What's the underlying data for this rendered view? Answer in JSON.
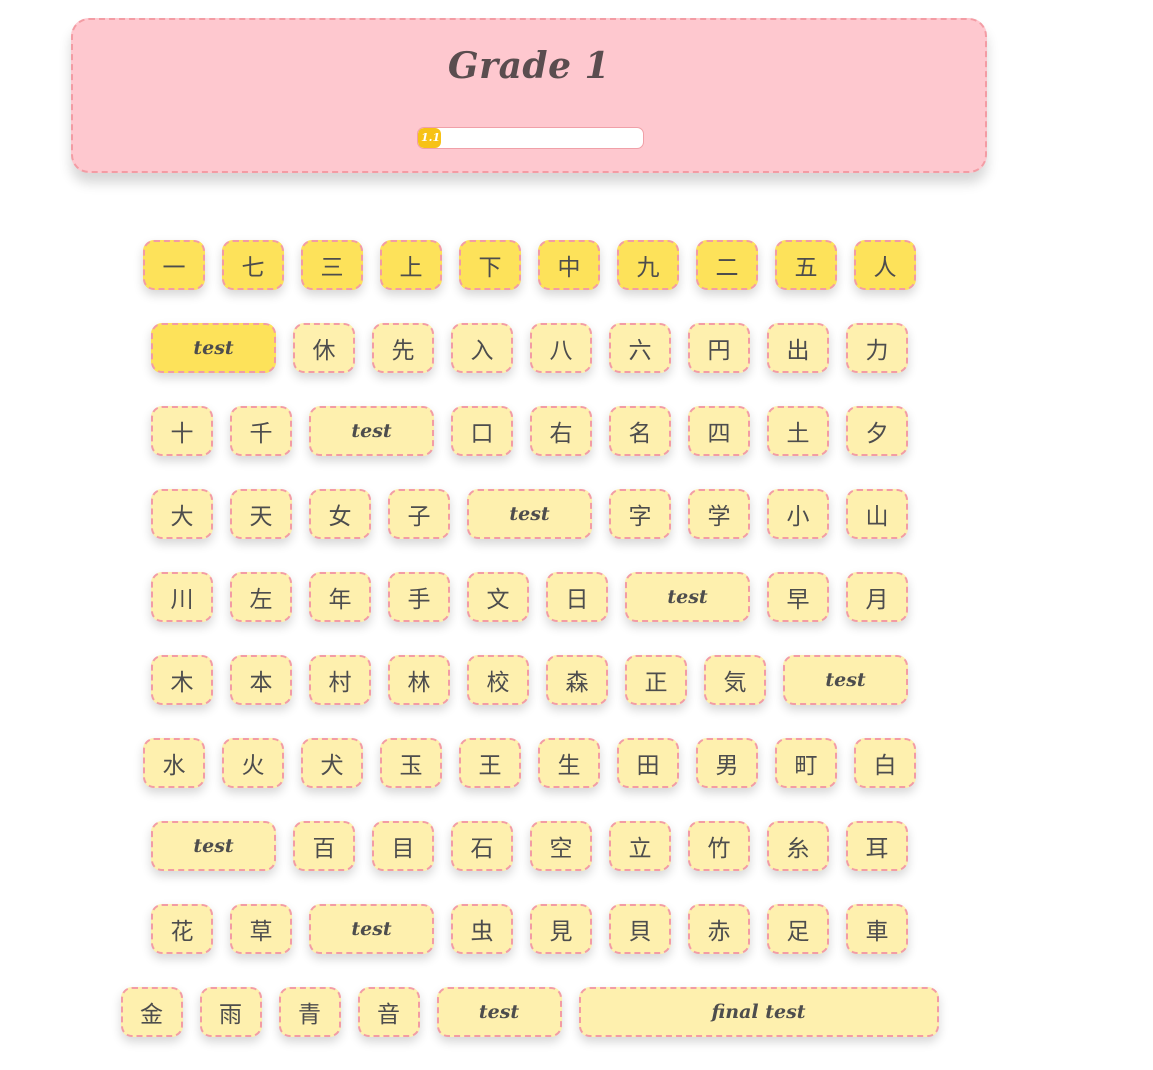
{
  "header": {
    "title": "Grade 1",
    "progress": {
      "label": "1.1",
      "fraction": 0.1
    }
  },
  "rows": [
    [
      {
        "label": "一",
        "state": "done"
      },
      {
        "label": "七",
        "state": "done"
      },
      {
        "label": "三",
        "state": "done"
      },
      {
        "label": "上",
        "state": "done"
      },
      {
        "label": "下",
        "state": "done"
      },
      {
        "label": "中",
        "state": "done"
      },
      {
        "label": "九",
        "state": "done"
      },
      {
        "label": "二",
        "state": "done"
      },
      {
        "label": "五",
        "state": "done"
      },
      {
        "label": "人",
        "state": "done"
      }
    ],
    [
      {
        "label": "test",
        "type": "test",
        "state": "done"
      },
      {
        "label": "休"
      },
      {
        "label": "先"
      },
      {
        "label": "入"
      },
      {
        "label": "八"
      },
      {
        "label": "六"
      },
      {
        "label": "円"
      },
      {
        "label": "出"
      },
      {
        "label": "力"
      }
    ],
    [
      {
        "label": "十"
      },
      {
        "label": "千"
      },
      {
        "label": "test",
        "type": "test"
      },
      {
        "label": "口"
      },
      {
        "label": "右"
      },
      {
        "label": "名"
      },
      {
        "label": "四"
      },
      {
        "label": "土"
      },
      {
        "label": "夕"
      }
    ],
    [
      {
        "label": "大"
      },
      {
        "label": "天"
      },
      {
        "label": "女"
      },
      {
        "label": "子"
      },
      {
        "label": "test",
        "type": "test"
      },
      {
        "label": "字"
      },
      {
        "label": "学"
      },
      {
        "label": "小"
      },
      {
        "label": "山"
      }
    ],
    [
      {
        "label": "川"
      },
      {
        "label": "左"
      },
      {
        "label": "年"
      },
      {
        "label": "手"
      },
      {
        "label": "文"
      },
      {
        "label": "日"
      },
      {
        "label": "test",
        "type": "test"
      },
      {
        "label": "早"
      },
      {
        "label": "月"
      }
    ],
    [
      {
        "label": "木"
      },
      {
        "label": "本"
      },
      {
        "label": "村"
      },
      {
        "label": "林"
      },
      {
        "label": "校"
      },
      {
        "label": "森"
      },
      {
        "label": "正"
      },
      {
        "label": "気"
      },
      {
        "label": "test",
        "type": "test"
      }
    ],
    [
      {
        "label": "水"
      },
      {
        "label": "火"
      },
      {
        "label": "犬"
      },
      {
        "label": "玉"
      },
      {
        "label": "王"
      },
      {
        "label": "生"
      },
      {
        "label": "田"
      },
      {
        "label": "男"
      },
      {
        "label": "町"
      },
      {
        "label": "白"
      }
    ],
    [
      {
        "label": "test",
        "type": "test"
      },
      {
        "label": "百"
      },
      {
        "label": "目"
      },
      {
        "label": "石"
      },
      {
        "label": "空"
      },
      {
        "label": "立"
      },
      {
        "label": "竹"
      },
      {
        "label": "糸"
      },
      {
        "label": "耳"
      }
    ],
    [
      {
        "label": "花"
      },
      {
        "label": "草"
      },
      {
        "label": "test",
        "type": "test"
      },
      {
        "label": "虫"
      },
      {
        "label": "見"
      },
      {
        "label": "貝"
      },
      {
        "label": "赤"
      },
      {
        "label": "足"
      },
      {
        "label": "車"
      }
    ],
    [
      {
        "label": "金"
      },
      {
        "label": "雨"
      },
      {
        "label": "青"
      },
      {
        "label": "音"
      },
      {
        "label": "test",
        "type": "test"
      },
      {
        "label": "final test",
        "type": "final"
      }
    ]
  ],
  "colors": {
    "header_bg": "#fec8cf",
    "border": "#f39ca4",
    "tile_bg": "#fef0ae",
    "tile_done_bg": "#fde25a",
    "progress_fill": "#f7c216",
    "text": "#4d4d4d"
  }
}
